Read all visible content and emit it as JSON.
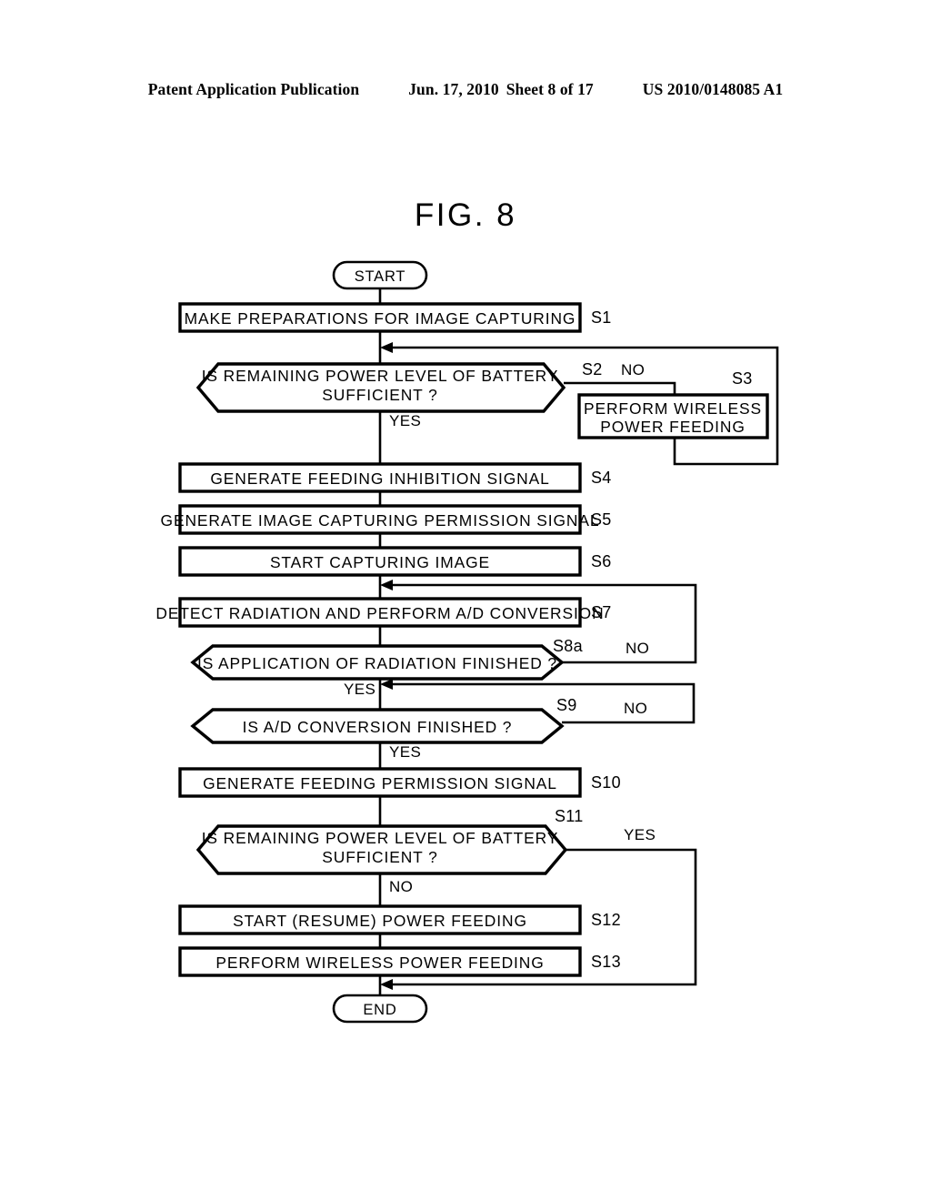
{
  "header": {
    "publication": "Patent Application Publication",
    "date": "Jun. 17, 2010",
    "sheet": "Sheet 8 of 17",
    "patent_number": "US 2010/0148085 A1"
  },
  "figure": {
    "title": "FIG. 8",
    "terminators": {
      "start": "START",
      "end": "END"
    },
    "steps": [
      {
        "id": "S1",
        "label": "S1",
        "text": "MAKE PREPARATIONS FOR IMAGE CAPTURING",
        "shape": "process"
      },
      {
        "id": "S2",
        "label": "S2",
        "text": "IS REMAINING POWER LEVEL OF BATTERY",
        "text2": "SUFFICIENT ?",
        "shape": "decision"
      },
      {
        "id": "S3",
        "label": "S3",
        "text": "PERFORM WIRELESS",
        "text2": "POWER FEEDING",
        "shape": "process"
      },
      {
        "id": "S4",
        "label": "S4",
        "text": "GENERATE FEEDING INHIBITION SIGNAL",
        "shape": "process"
      },
      {
        "id": "S5",
        "label": "S5",
        "text": "GENERATE IMAGE CAPTURING PERMISSION SIGNAL",
        "shape": "process"
      },
      {
        "id": "S6",
        "label": "S6",
        "text": "START CAPTURING IMAGE",
        "shape": "process"
      },
      {
        "id": "S7",
        "label": "S7",
        "text": "DETECT RADIATION AND PERFORM A/D CONVERSION",
        "shape": "process"
      },
      {
        "id": "S8a",
        "label": "S8a",
        "text": "IS APPLICATION OF RADIATION FINISHED ?",
        "shape": "decision"
      },
      {
        "id": "S9",
        "label": "S9",
        "text": "IS A/D CONVERSION FINISHED ?",
        "shape": "decision"
      },
      {
        "id": "S10",
        "label": "S10",
        "text": "GENERATE FEEDING PERMISSION SIGNAL",
        "shape": "process"
      },
      {
        "id": "S11",
        "label": "S11",
        "text": "IS REMAINING POWER LEVEL OF BATTERY",
        "text2": "SUFFICIENT ?",
        "shape": "decision"
      },
      {
        "id": "S12",
        "label": "S12",
        "text": "START (RESUME) POWER FEEDING",
        "shape": "process"
      },
      {
        "id": "S13",
        "label": "S13",
        "text": "PERFORM WIRELESS POWER FEEDING",
        "shape": "process"
      }
    ],
    "branches": [
      {
        "from": "S2",
        "label": "NO",
        "target": "S3"
      },
      {
        "from": "S2",
        "label": "YES",
        "target": "S4"
      },
      {
        "from": "S8a",
        "label": "NO",
        "target": "S7"
      },
      {
        "from": "S8a",
        "label": "YES",
        "target": "S9"
      },
      {
        "from": "S9",
        "label": "NO",
        "target": "S8a-yes"
      },
      {
        "from": "S9",
        "label": "YES",
        "target": "S10"
      },
      {
        "from": "S11",
        "label": "YES",
        "target": "END"
      },
      {
        "from": "S11",
        "label": "NO",
        "target": "S12"
      }
    ]
  }
}
